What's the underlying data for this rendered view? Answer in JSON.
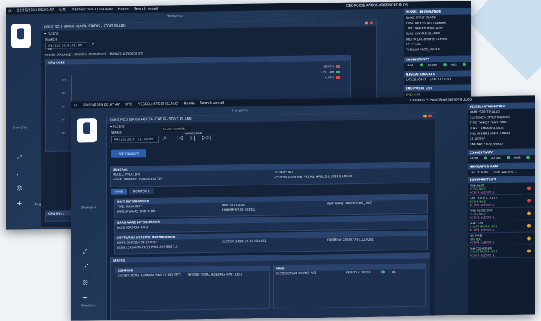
{
  "topbar": {
    "datetime": "12/05/2024 06:07:47",
    "timezone": "UTC",
    "vessel": "VESSEL: STOLT ISLAND",
    "home": "Home",
    "search_placeholder": "Search vessel",
    "user": "GEORGIOS PANOS-ARSENOPOULOS"
  },
  "map": {
    "labels": [
      "Hangzhou",
      "Shanghai",
      "Ningbo",
      "Wenzhou"
    ],
    "colors": {
      "sea": "#1c3150",
      "panel": "#15233a"
    }
  },
  "back_window": {
    "panel_title": "ECDIS NO.1 (ENAV) HEALTH STATUS - STOLT ISLAND",
    "filters_label": "FILTERS",
    "search_label": "SEARCH",
    "date_value": "04 / 25 / 2024 , 01 : 00 PM",
    "period_text": "PERIOD AVAILABLE: 14/04/2024 00:00:00 UTC - 26/04/2024 13:00:00 UTC",
    "cpu_core_title": "CPU CORE",
    "cpu_legend": [
      "L2C(%)",
      "CPU Core",
      "L3(%)"
    ],
    "cpu_y_ticks": [
      "100",
      "80",
      "60",
      "40",
      "20"
    ],
    "cpu_bottom_title": "CPU BU..."
  },
  "front_window": {
    "panel_title": "ECDIS NO.2 (ENAV) HEALTH STATUS - STOLT ISLAND",
    "filters_label": "FILTERS",
    "search_label": "SEARCH",
    "tooltip": "Search Health Sta...",
    "navigation_label": "NAVIGATION",
    "date_value": "04 / 25 / 2024 , 01 : 00 PM",
    "update_button": "SEE CHANGES",
    "general": {
      "title": "GENERAL",
      "model": "MODEL: FMD-3100",
      "serial": "SERIAL NUMBER: 1K0013-181727",
      "version": "LICENSE: NO",
      "system_date": "SYSTEM DATE/TIME: FRIDAY, APRIL 26, 2024 13:00:00"
    },
    "tabs": [
      "MAIN",
      "MONITOR 1"
    ],
    "unit_info": {
      "title": "UNIT INFORMATION",
      "type": "TYPE: MAIN_UNIT",
      "unit": "UNIT: PCU-2006",
      "unit_name": "UNIT NAME: PROCESSOR_UNIT",
      "parent": "PARENT NAME: FMD-3100",
      "equipment": "EQUIPMENT ID: ECDIS2"
    },
    "hardware": {
      "title": "HARDWARE INFORMATION",
      "base": "BASE VERSION: 4.6.3"
    },
    "software": {
      "title": "SOFTWARE VERSION INFORMATION",
      "boot": "BOOT: 2450116-03.22.0261",
      "system": "SYSTEM: 2450116-03.22.0261",
      "common": "COMMON: 2450077-03.22.0261",
      "ecdis": "ECDIS: 2450074-03.22.0261-20230613-6"
    },
    "status": {
      "title": "STATUS",
      "common": "COMMON",
      "main": "MAIN",
      "running1": "SYSTEM TOTAL RUNNING TIME (1-100 DEC)",
      "running2": "SYSTEM TOTAL RUNNING TIME (DEC)",
      "start_count": "SYSTEM START COUNT: 783",
      "self_test": "SELF TEST RESULT",
      "self_test_value": "OK"
    }
  },
  "vessel_info": {
    "title": "VESSEL INFORMATION",
    "lines": [
      "NAME: STOLT ISLAND",
      "CUSTOMER: STOLT TANKERS",
      "TYPE: TANKER     YEAR: 2009",
      "FLAG: CAYMAN ISLANDS",
      "IMO: 9414838     MMSI: 319968...",
      "CS: ZCGG7",
      "TIMEWAY: FROD_SW363"
    ],
    "connectivity_title": "CONNECTIVITY",
    "connectivity": [
      "TR-VO",
      "AZURE",
      "AMS"
    ],
    "navigation_title": "NAVIGATION DATA",
    "lat": "LAT: 28.40867",
    "lon": "LON: 122.5787...",
    "equipment_title": "EQUIPMENT LIST",
    "equipment": [
      {
        "name": "FMD-3100",
        "sub": "ECDIS NO.1",
        "alerts": "ACTIVE ALERTS: 1",
        "color": "#e04545"
      },
      {
        "name": "S/N: 1K0013-181727",
        "sub": "ECDIS NO.2",
        "alerts": "ACTIVE ALERTS: 2",
        "color": "#e04545"
      },
      {
        "name": "FMD-3100(3300)",
        "sub": "ECDIS NO.2",
        "alerts": "ACTIVE ALERTS: 1",
        "color": "#e0a030"
      },
      {
        "name": "FAR-3320",
        "sub": "CHART RADAR NO.1",
        "alerts": "ACTIVE ALERTS: 1",
        "color": "#e0a030"
      },
      {
        "name": "NX-700B",
        "sub": "NAVTEX",
        "alerts": "ACTIVE ALERTS: 1",
        "color": "#e0a030"
      },
      {
        "name": "FAR-3320(3320)",
        "sub": "CHART RADAR NO.2",
        "alerts": "ACTIVE ALERTS: 1",
        "color": "#e0a030"
      }
    ]
  }
}
